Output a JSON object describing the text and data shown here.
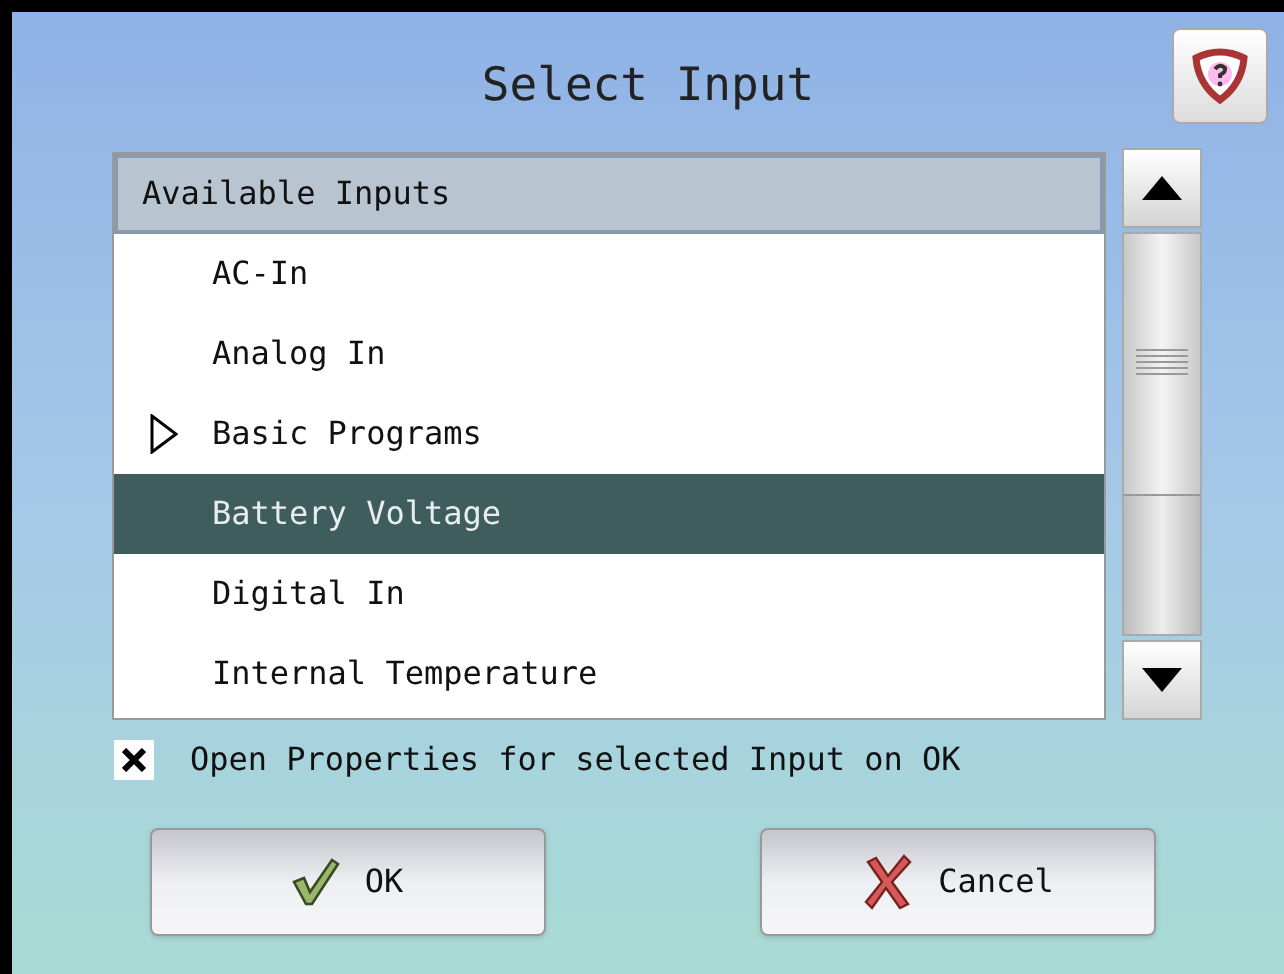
{
  "window": {
    "title": "Select Input"
  },
  "list": {
    "header": "Available Inputs",
    "items": [
      {
        "label": "AC-In",
        "kind": "leaf",
        "selected": false
      },
      {
        "label": "Analog In",
        "kind": "leaf",
        "selected": false
      },
      {
        "label": "Basic Programs",
        "kind": "group",
        "selected": false
      },
      {
        "label": "Battery Voltage",
        "kind": "leaf",
        "selected": true
      },
      {
        "label": "Digital In",
        "kind": "leaf",
        "selected": false
      },
      {
        "label": "Internal Temperature",
        "kind": "leaf",
        "selected": false
      }
    ]
  },
  "option": {
    "label": "Open Properties for selected Input on OK",
    "checked": true
  },
  "buttons": [
    {
      "label": "OK",
      "kind": "ok"
    },
    {
      "label": "Cancel",
      "kind": "cancel"
    }
  ]
}
